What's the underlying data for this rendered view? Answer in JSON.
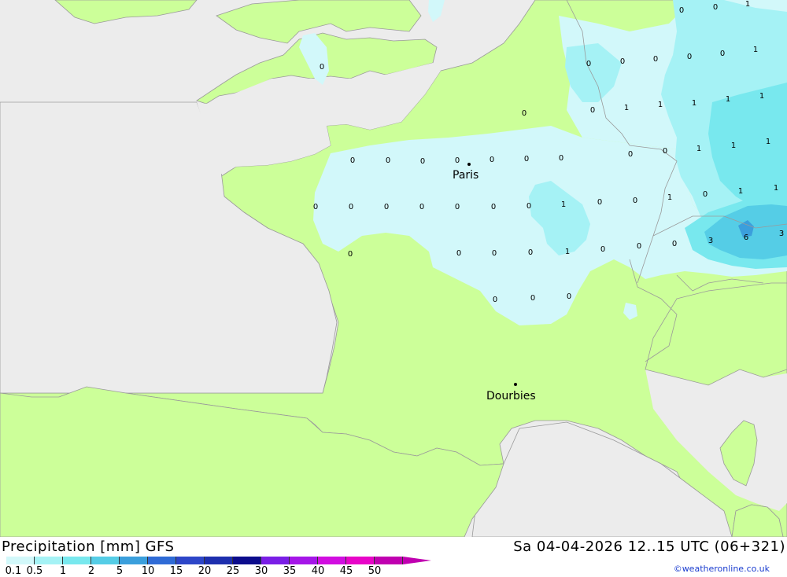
{
  "header": {
    "title_left": "Precipitation [mm] GFS",
    "title_right": "Sa 04-04-2026 12..15 UTC (06+321)"
  },
  "credit": "©weatheronline.co.uk",
  "colors": {
    "sea": "#ececec",
    "land": "#ccff99",
    "precip_01": "#d2f8fa",
    "precip_05": "#a5f2f5",
    "precip_1": "#78e8ee",
    "precip_2": "#55cde6",
    "precip_5": "#3b9fdc"
  },
  "legend": {
    "labels": [
      "0.1",
      "0.5",
      "1",
      "2",
      "5",
      "10",
      "15",
      "20",
      "25",
      "30",
      "35",
      "40",
      "45",
      "50"
    ],
    "colors": [
      "#d2f8fa",
      "#a5f2f5",
      "#78e8ee",
      "#55cde6",
      "#3b9fdc",
      "#2f6bd6",
      "#2d46c8",
      "#1d2fae",
      "#0c0c8c",
      "#7a1ee6",
      "#a516e8",
      "#d10ee0",
      "#e805c8",
      "#c000b0"
    ]
  },
  "cities": [
    {
      "name": "Paris"
    },
    {
      "name": "Dourbies"
    }
  ],
  "grid_values": [
    "0",
    "0",
    "1",
    "0",
    "0",
    "0",
    "0",
    "0",
    "1",
    "0",
    "0",
    "0",
    "0",
    "0",
    "1",
    "1",
    "1",
    "0",
    "0",
    "1",
    "1",
    "0",
    "0",
    "0",
    "0",
    "0",
    "0",
    "0",
    "1",
    "1",
    "0",
    "0",
    "0",
    "0",
    "0",
    "0",
    "0",
    "0",
    "1",
    "0",
    "1",
    "0",
    "1",
    "0",
    "0",
    "0",
    "0",
    "1",
    "0",
    "0",
    "3",
    "6",
    "3",
    "0",
    "0",
    "0"
  ]
}
